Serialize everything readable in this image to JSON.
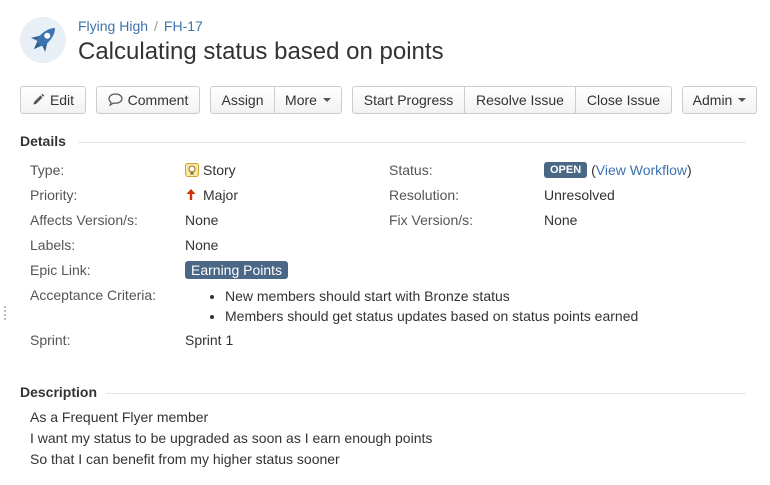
{
  "breadcrumb": {
    "project": "Flying High",
    "separator": "/",
    "issue_key": "FH-17"
  },
  "issue": {
    "title": "Calculating status based on points"
  },
  "toolbar": {
    "edit": "Edit",
    "comment": "Comment",
    "assign": "Assign",
    "more": "More",
    "start_progress": "Start Progress",
    "resolve_issue": "Resolve Issue",
    "close_issue": "Close Issue",
    "admin": "Admin"
  },
  "details": {
    "heading": "Details",
    "type": {
      "label": "Type:",
      "value": "Story",
      "icon": "story-lightbulb-icon"
    },
    "priority": {
      "label": "Priority:",
      "value": "Major",
      "icon": "arrow-up-icon",
      "color": "#cc3300"
    },
    "affects_version": {
      "label": "Affects Version/s:",
      "value": "None"
    },
    "labels": {
      "label": "Labels:",
      "value": "None"
    },
    "epic_link": {
      "label": "Epic Link:",
      "value": "Earning Points"
    },
    "acceptance_criteria": {
      "label": "Acceptance Criteria:",
      "items": [
        "New members should start with Bronze status",
        "Members should get status updates based on status points earned"
      ]
    },
    "sprint": {
      "label": "Sprint:",
      "value": "Sprint 1"
    },
    "status": {
      "label": "Status:",
      "value": "OPEN",
      "link_open": "(",
      "link": "View Workflow",
      "link_close": ")"
    },
    "resolution": {
      "label": "Resolution:",
      "value": "Unresolved"
    },
    "fix_version": {
      "label": "Fix Version/s:",
      "value": "None"
    }
  },
  "description": {
    "heading": "Description",
    "lines": [
      "As a Frequent Flyer member",
      "I want my status to be upgraded as soon as I earn enough points",
      "So that I can benefit from my higher status sooner"
    ]
  },
  "colors": {
    "link": "#3b73af",
    "badge": "#4a6785",
    "priority": "#cc3300"
  }
}
